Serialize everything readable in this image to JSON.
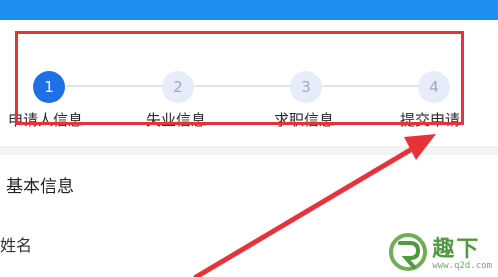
{
  "steps": [
    {
      "number": "1",
      "label": "申请人信息",
      "active": true
    },
    {
      "number": "2",
      "label": "失业信息",
      "active": false
    },
    {
      "number": "3",
      "label": "求职信息",
      "active": false
    },
    {
      "number": "4",
      "label": "提交申请",
      "active": false
    }
  ],
  "section": {
    "title": "基本信息"
  },
  "fields": {
    "name_label": "姓名"
  },
  "colors": {
    "topbar": "#1e8ff0",
    "step_active": "#1f6fe6",
    "step_inactive": "#e7edf8",
    "highlight": "#e8323a",
    "watermark": "#4f9a3c"
  },
  "watermark": {
    "logo_text": "趣下",
    "url": "www.q2d.com"
  }
}
